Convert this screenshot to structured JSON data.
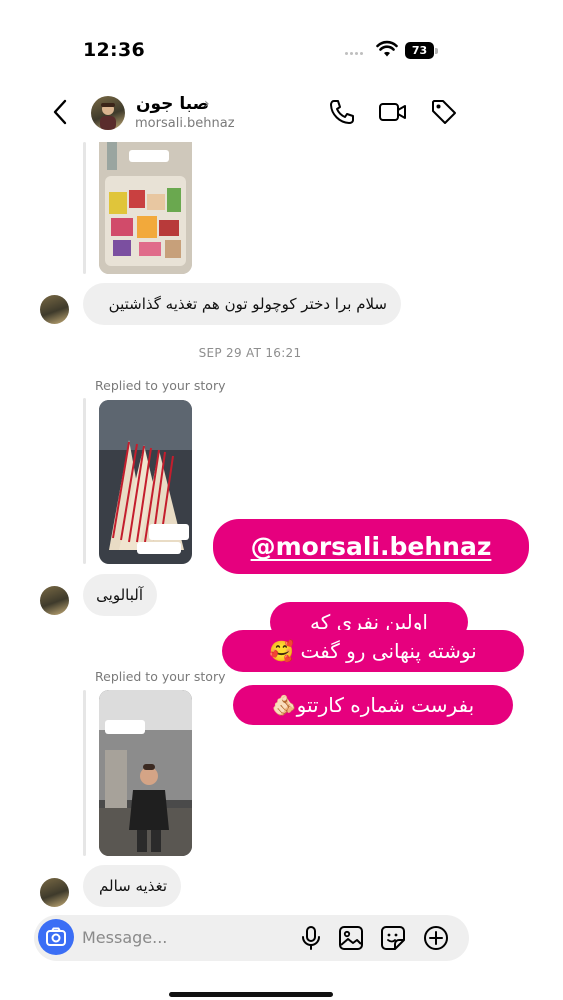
{
  "status": {
    "time": "12:36",
    "battery": "73"
  },
  "header": {
    "name": "صبا جون",
    "chevron": "›",
    "username": "morsali.behnaz"
  },
  "messages": {
    "m1_text": "سلام برا دختر کوچولو تون هم تغذیه گذاشتین",
    "timestamp": "SEP 29 AT 16:21",
    "replied_1": "Replied to your story",
    "m2_text": "آلبالویی",
    "replied_2": "Replied to your story",
    "m3_text": "تغذیه سالم"
  },
  "overlay": {
    "handle": "@morsali.behnaz",
    "line1": "اولین نفری که",
    "line2": "نوشته پنهانی رو گفت 🥰",
    "line3": "بفرست شماره کارتتو🫵🏻"
  },
  "composer": {
    "placeholder": "Message..."
  },
  "colors": {
    "accent_pink": "#e6007e",
    "camera_blue": "#3b6ef5",
    "bubble_gray": "#efefef"
  },
  "icons": [
    "back-icon",
    "phone-icon",
    "video-icon",
    "tag-icon",
    "camera-icon",
    "mic-icon",
    "gallery-icon",
    "sticker-icon",
    "plus-icon"
  ]
}
